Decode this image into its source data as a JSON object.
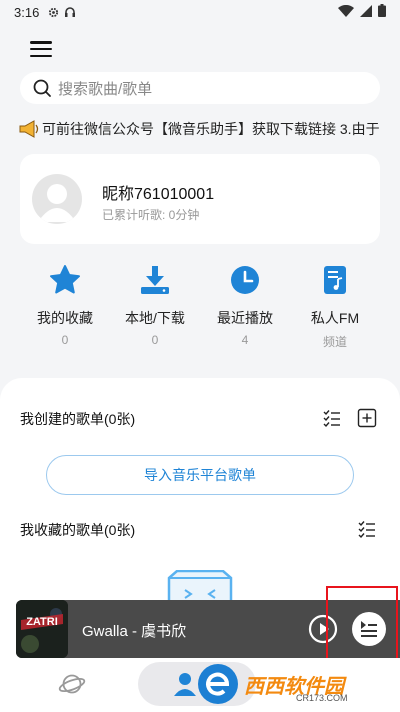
{
  "status_bar": {
    "time": "3:16"
  },
  "search": {
    "placeholder": "搜索歌曲/歌单"
  },
  "notice": {
    "text": "可前往微信公众号【微音乐助手】获取下载链接  3.由于"
  },
  "profile": {
    "nickname": "昵称761010001",
    "listen_time": "已累计听歌: 0分钟"
  },
  "quick": [
    {
      "label": "我的收藏",
      "sub": "0",
      "icon": "star-icon"
    },
    {
      "label": "本地/下载",
      "sub": "0",
      "icon": "download-icon"
    },
    {
      "label": "最近播放",
      "sub": "4",
      "icon": "clock-icon"
    },
    {
      "label": "私人FM",
      "sub": "频道",
      "icon": "music-doc-icon"
    }
  ],
  "sections": {
    "created": "我创建的歌单(0张)",
    "import_button": "导入音乐平台歌单",
    "collected": "我收藏的歌单(0张)"
  },
  "player": {
    "song": "Gwalla  -  虞书欣",
    "cover_text": "ZATRI"
  },
  "watermark": {
    "brand": "西西软件园",
    "url": "CR173.COM"
  },
  "colors": {
    "accent": "#1f84d6",
    "highlight": "#e8141c",
    "watermark": "#f38a10"
  }
}
